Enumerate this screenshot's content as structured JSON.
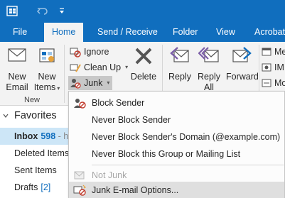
{
  "qat": {
    "items": [
      "app-icon",
      "undo-icon",
      "customize-icon"
    ]
  },
  "tabs": [
    {
      "label": "File"
    },
    {
      "label": "Home"
    },
    {
      "label": "Send / Receive"
    },
    {
      "label": "Folder"
    },
    {
      "label": "View"
    },
    {
      "label": "Acrobat"
    }
  ],
  "ribbon": {
    "new_email": "New\nEmail",
    "new_email_l1": "New",
    "new_email_l2": "Email",
    "new_items_l1": "New",
    "new_items_l2": "Items",
    "group_new": "New",
    "ignore": "Ignore",
    "clean_up": "Clean Up",
    "junk": "Junk",
    "delete": "Delete",
    "reply": "Reply",
    "reply_all_l1": "Reply",
    "reply_all_l2": "All",
    "forward": "Forward",
    "clip1": "Me",
    "clip2": "IM",
    "clip3": "Mo"
  },
  "pane": {
    "favorites": "Favorites",
    "folders": [
      {
        "name": "Inbox",
        "count": "598",
        "suffix": " - h"
      },
      {
        "name": "Deleted Items"
      },
      {
        "name": "Sent Items"
      },
      {
        "name": "Drafts",
        "count": "[2]"
      }
    ]
  },
  "junk_menu": {
    "block_sender": "Block Sender",
    "never_block_sender": "Never Block Sender",
    "never_block_domain": "Never Block Sender's Domain (@example.com)",
    "never_block_group": "Never Block this Group or Mailing List",
    "not_junk": "Not Junk",
    "junk_options": "Junk E-mail Options..."
  },
  "colors": {
    "brand": "#106ebe",
    "ribbon_bg": "#f3f3f3",
    "selected_folder": "#cde6f7",
    "menu_hover": "#dfdfdf"
  }
}
